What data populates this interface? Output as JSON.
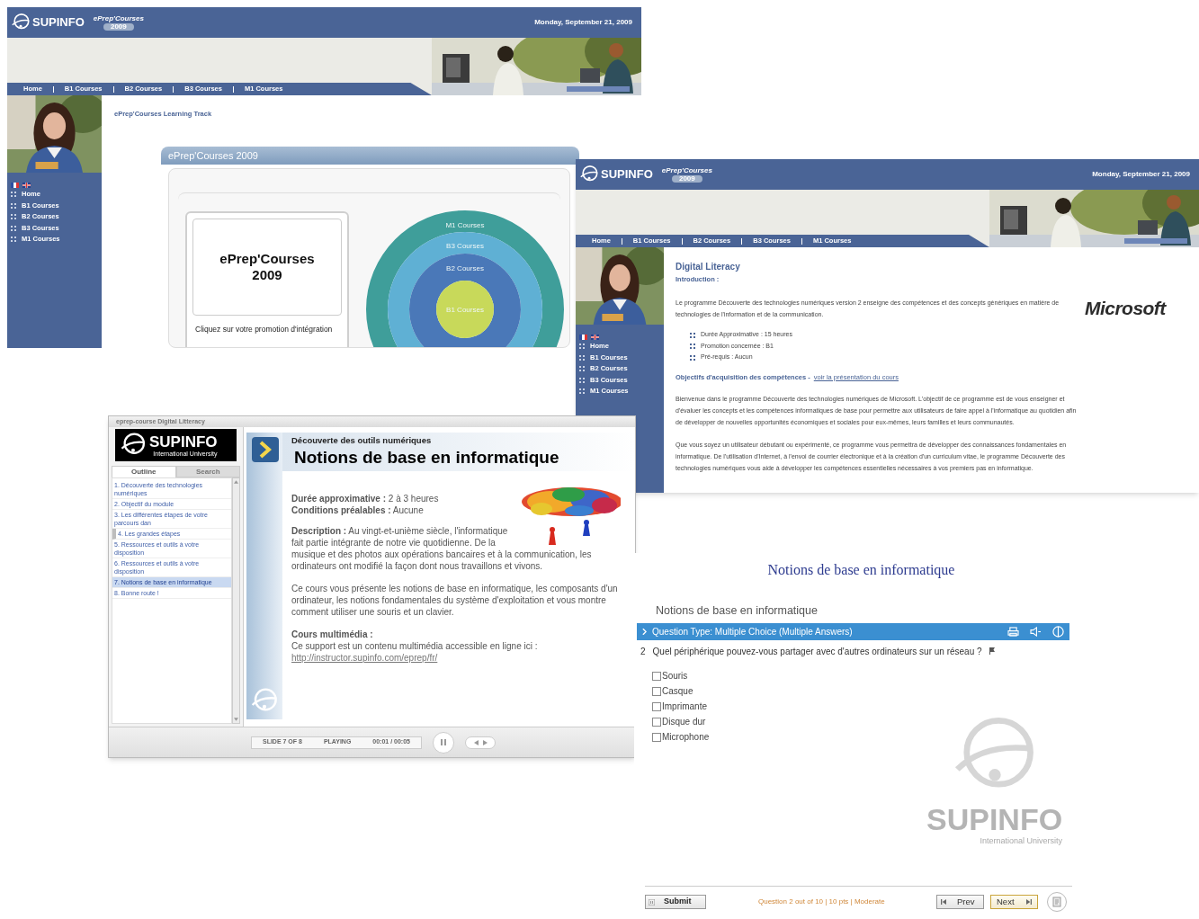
{
  "portal_home": {
    "header": {
      "logo": "SUPINFO",
      "product": "ePrep'Courses",
      "product_year": "2009",
      "date": "Monday, September 21, 2009"
    },
    "nav": [
      "Home",
      "B1 Courses",
      "B2 Courses",
      "B3 Courses",
      "M1 Courses"
    ],
    "sidebar": [
      "Home",
      "B1 Courses",
      "B2 Courses",
      "B3 Courses",
      "M1 Courses"
    ],
    "breadcrumb": "ePrep'Courses Learning Track",
    "panel_title": "ePrep'Courses 2009",
    "card": {
      "title": "ePrep'Courses",
      "year": "2009",
      "caption": "Cliquez sur votre promotion d'intégration"
    },
    "rings": [
      {
        "label": "M1 Courses",
        "color": "#3f9e9a"
      },
      {
        "label": "B3 Courses",
        "color": "#5fb0d4"
      },
      {
        "label": "B2 Courses",
        "color": "#4a78b8"
      },
      {
        "label": "B1 Courses",
        "color": "#c8d95a"
      }
    ]
  },
  "portal_course": {
    "header": {
      "logo": "SUPINFO",
      "product": "ePrep'Courses",
      "product_year": "2009",
      "date": "Monday, September 21, 2009"
    },
    "nav": [
      "Home",
      "B1 Courses",
      "B2 Courses",
      "B3 Courses",
      "M1 Courses"
    ],
    "sidebar": [
      "Home",
      "B1 Courses",
      "B2 Courses",
      "B3 Courses",
      "M1 Courses"
    ],
    "title": "Digital Literacy",
    "subtitle": "Introduction :",
    "intro": "Le programme Découverte des technologies numériques version 2 enseigne des compétences et des concepts génériques en matière de technologies de l'information et de la communication.",
    "facts": [
      "Durée Approximative : 15 heures",
      "Promotion concernée : B1",
      "Pré-requis : Aucun"
    ],
    "objectives_label": "Objectifs d'acquisition des compétences -",
    "objectives_link": "voir la présentation du cours",
    "paragraphs": [
      "Bienvenue dans le programme Découverte des technologies numériques de Microsoft. L'objectif de ce programme est de vous enseigner et d'évaluer les concepts et les compétences informatiques de base pour permettre aux utilisateurs de faire appel à l'informatique au quotidien afin de développer de nouvelles opportunités économiques et sociales pour eux-mêmes, leurs familles et leurs communautés.",
      "Que vous soyez un utilisateur débutant ou expérimenté, ce programme vous permettra de développer des connaissances fondamentales en informatique. De l'utilisation d'Internet, à l'envoi de courrier électronique et à la création d'un curriculum vitae, le programme Découverte des technologies numériques vous aide à développer les compétences essentielles nécessaires à vos premiers pas en informatique."
    ],
    "partner_logo": "Microsoft"
  },
  "slide_player": {
    "title": "eprep-course Digital Litteracy",
    "logo": "SUPINFO",
    "logo_tagline": "International University",
    "tabs": [
      {
        "label": "Outline",
        "selected": true
      },
      {
        "label": "Search",
        "selected": false
      }
    ],
    "outline": [
      {
        "label": "1. Découverte des technologies numériques",
        "selected": false,
        "highlighted": false
      },
      {
        "label": "2. Objectif du module",
        "selected": false,
        "highlighted": false
      },
      {
        "label": "3. Les différentes étapes de votre parcours dan",
        "selected": false,
        "highlighted": false
      },
      {
        "label": "4. Les grandes étapes",
        "selected": false,
        "highlighted": true
      },
      {
        "label": "5. Ressources et outils à votre disposition",
        "selected": false,
        "highlighted": false
      },
      {
        "label": "6. Ressources et outils à votre disposition",
        "selected": false,
        "highlighted": false
      },
      {
        "label": "7. Notions de base en informatique",
        "selected": true,
        "highlighted": false
      },
      {
        "label": "8. Bonne route !",
        "selected": false,
        "highlighted": false
      }
    ],
    "slide": {
      "kicker": "Découverte des outils numériques",
      "title": "Notions de base en informatique",
      "facts": [
        "**Durée approximative :** 2 à 3 heures",
        "**Conditions préalables :** Aucune"
      ],
      "paragraphs": [
        "**Description :** Au vingt-et-unième siècle, l'informatique fait partie intégrante de notre vie quotidienne. De la musique et des photos aux opérations bancaires et à la communication, les ordinateurs ont modifié la façon dont nous travaillons et vivons.",
        "Ce cours vous présente les notions de base en informatique, les composants d'un ordinateur, les notions fondamentales du système d'exploitation et vous montre comment utiliser une souris et un clavier."
      ],
      "media_heading": "Cours multimédia :",
      "media_text": "Ce support est un contenu multimédia accessible en ligne ici :",
      "media_link": "http://instructor.supinfo.com/eprep/fr/"
    },
    "controls": {
      "slide_counter": "SLIDE 7 OF 8",
      "status": "PLAYING",
      "time": "00:01 / 00:05",
      "playing": true
    }
  },
  "quiz": {
    "title": "Notions de base en informatique",
    "section": "Notions de base en informatique",
    "question_type": "Question Type: Multiple Choice (Multiple Answers)",
    "question_number": "2",
    "question": "Quel périphérique pouvez-vous partager avec d'autres ordinateurs sur un réseau ?",
    "options": [
      {
        "label": "Souris",
        "checked": false
      },
      {
        "label": "Casque",
        "checked": false
      },
      {
        "label": "Imprimante",
        "checked": false
      },
      {
        "label": "Disque dur",
        "checked": false
      },
      {
        "label": "Microphone",
        "checked": false
      }
    ],
    "background_logo": {
      "logo": "SUPINFO",
      "tagline": "International University"
    },
    "submit": "Submit",
    "status": "Question 2 out of 10 | 10 pts | Moderate",
    "prev": "Prev",
    "next": "Next"
  }
}
